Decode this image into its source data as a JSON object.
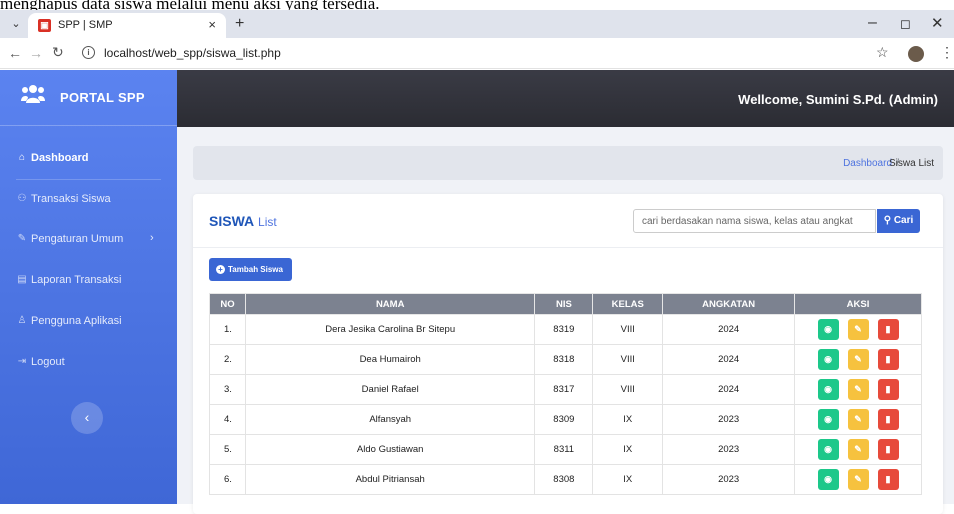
{
  "caption": "menghapus data siswa melalui menu aksi yang tersedia.",
  "browser": {
    "tab_title": "SPP | SMP",
    "url": "localhost/web_spp/siswa_list.php"
  },
  "brand": {
    "name": "PORTAL SPP"
  },
  "topbar": {
    "welcome": "Wellcome, Sumini S.Pd. (Admin)"
  },
  "sidebar": {
    "items": [
      {
        "label": "Dashboard",
        "icon": "home-icon"
      },
      {
        "label": "Transaksi Siswa",
        "icon": "users-icon"
      },
      {
        "label": "Pengaturan Umum",
        "icon": "wrench-icon"
      },
      {
        "label": "Laporan Transaksi",
        "icon": "file-icon"
      },
      {
        "label": "Pengguna Aplikasi",
        "icon": "user-icon"
      },
      {
        "label": "Logout",
        "icon": "logout-icon"
      }
    ]
  },
  "breadcrumb": {
    "home": "Dashboard",
    "separator": "/",
    "current": "Siswa List"
  },
  "card": {
    "title_main": "SISWA",
    "title_sub": "List",
    "search_placeholder": "cari berdasakan nama siswa, kelas atau angkat",
    "search_button": "Cari",
    "add_button": "Tambah Siswa"
  },
  "table": {
    "headers": [
      "NO",
      "NAMA",
      "NIS",
      "KELAS",
      "ANGKATAN",
      "AKSI"
    ],
    "rows": [
      {
        "no": "1.",
        "nama": "Dera Jesika Carolina Br Sitepu",
        "nis": "8319",
        "kelas": "VIII",
        "angkatan": "2024"
      },
      {
        "no": "2.",
        "nama": "Dea Humairoh",
        "nis": "8318",
        "kelas": "VIII",
        "angkatan": "2024"
      },
      {
        "no": "3.",
        "nama": "Daniel Rafael",
        "nis": "8317",
        "kelas": "VIII",
        "angkatan": "2024"
      },
      {
        "no": "4.",
        "nama": "Alfansyah",
        "nis": "8309",
        "kelas": "IX",
        "angkatan": "2023"
      },
      {
        "no": "5.",
        "nama": "Aldo Gustiawan",
        "nis": "8311",
        "kelas": "IX",
        "angkatan": "2023"
      },
      {
        "no": "6.",
        "nama": "Abdul Pitriansah",
        "nis": "8308",
        "kelas": "IX",
        "angkatan": "2023"
      }
    ]
  },
  "colors": {
    "sidebar": "#4e73df",
    "topbar": "#2f3038",
    "view": "#1cc88a",
    "edit": "#f6c23e",
    "delete": "#e74a3b"
  }
}
